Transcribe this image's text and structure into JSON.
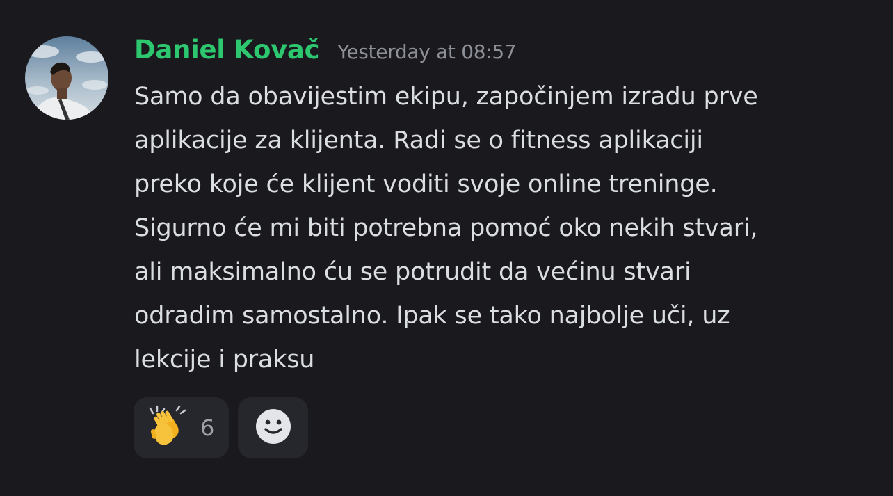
{
  "message": {
    "author": "Daniel Kovač",
    "timestamp": "Yesterday at 08:57",
    "author_color": "#2dc770",
    "content_lines": [
      "Samo da obavijestim ekipu, započinjem izradu prve",
      "aplikacije za klijenta. Radi se o fitness aplikaciji",
      "preko koje će klijent voditi svoje online treninge.",
      "Sigurno će mi biti potrebna pomoć oko nekih stvari,",
      "ali maksimalno ću se potrudit da većinu stvari",
      "odradim samostalno. Ipak se tako najbolje uči, uz",
      "lekcije i praksu"
    ]
  },
  "reactions": [
    {
      "icon": "clapping-hands-icon",
      "count": "6"
    }
  ],
  "add_reaction": {
    "icon": "smiley-face-icon"
  }
}
